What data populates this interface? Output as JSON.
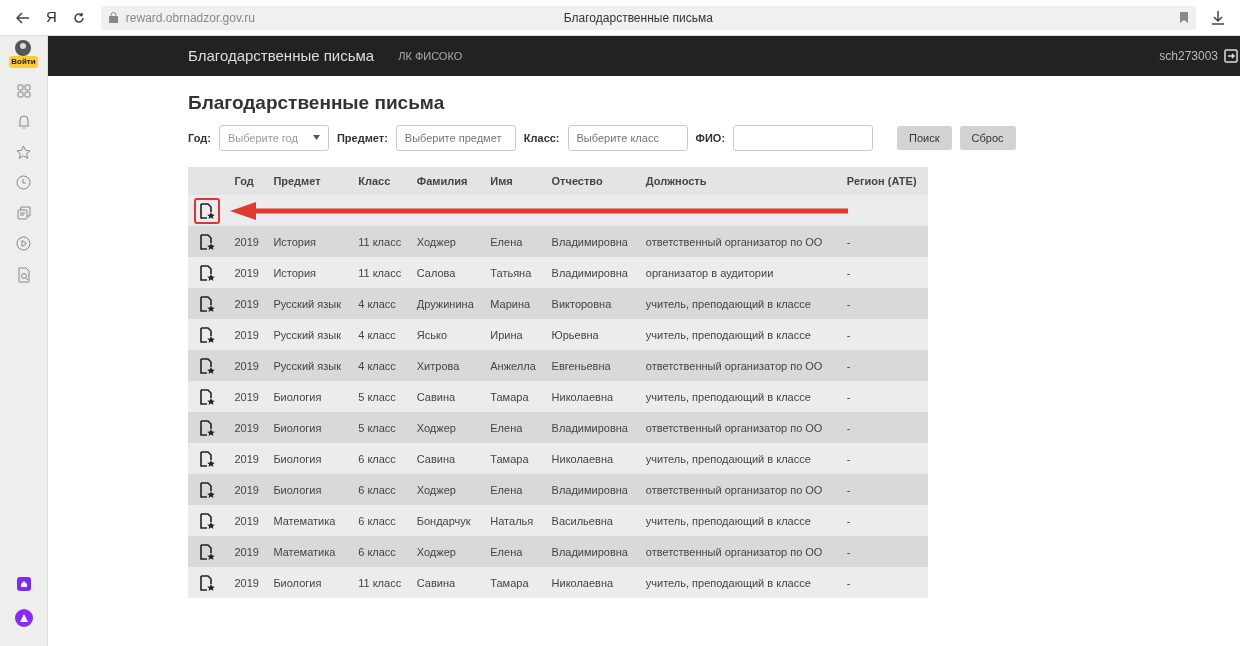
{
  "browser": {
    "logo": "Я",
    "url": "reward.obrnadzor.gov.ru",
    "title": "Благодарственные письма"
  },
  "sidebar": {
    "login": "Войти"
  },
  "navbar": {
    "brand": "Благодарственные письма",
    "links": [
      "ЛК ФИСОКО"
    ],
    "user": "sch273003"
  },
  "heading": "Благодарственные письма",
  "filters": [
    {
      "kind": "select",
      "label": "Год:",
      "placeholder": "Выберите год"
    },
    {
      "kind": "input",
      "label": "Предмет:",
      "placeholder": "Выберите предмет"
    },
    {
      "kind": "input",
      "label": "Класс:",
      "placeholder": "Выберите класс"
    },
    {
      "kind": "input",
      "label": "ФИО:"
    }
  ],
  "buttons": [
    "Поиск",
    "Сброс"
  ],
  "table": {
    "columns": [
      "Год",
      "Предмет",
      "Класс",
      "Фамилия",
      "Имя",
      "Отчество",
      "Должность",
      "Регион (АТЕ)"
    ],
    "rows": [
      {
        "highlighted": true,
        "cells": []
      },
      {
        "highlighted": false,
        "cells": [
          "2019",
          "История",
          "11 класс",
          "Ходжер",
          "Елена",
          "Владимировна",
          "ответственный организатор по ОО",
          "-"
        ]
      },
      {
        "highlighted": false,
        "cells": [
          "2019",
          "История",
          "11 класс",
          "Салова",
          "Татьяна",
          "Владимировна",
          "организатор в аудитории",
          "-"
        ]
      },
      {
        "highlighted": false,
        "cells": [
          "2019",
          "Русский язык",
          "4 класс",
          "Дружинина",
          "Марина",
          "Викторовна",
          "учитель, преподающий в классе",
          "-"
        ]
      },
      {
        "highlighted": false,
        "cells": [
          "2019",
          "Русский язык",
          "4 класс",
          "Ясько",
          "Ирина",
          "Юрьевна",
          "учитель, преподающий в классе",
          "-"
        ]
      },
      {
        "highlighted": false,
        "cells": [
          "2019",
          "Русский язык",
          "4 класс",
          "Хитрова",
          "Анжелла",
          "Евгеньевна",
          "ответственный организатор по ОО",
          "-"
        ]
      },
      {
        "highlighted": false,
        "cells": [
          "2019",
          "Биология",
          "5 класс",
          "Савина",
          "Тамара",
          "Николаевна",
          "учитель, преподающий в классе",
          "-"
        ]
      },
      {
        "highlighted": false,
        "cells": [
          "2019",
          "Биология",
          "5 класс",
          "Ходжер",
          "Елена",
          "Владимировна",
          "ответственный организатор по ОО",
          "-"
        ]
      },
      {
        "highlighted": false,
        "cells": [
          "2019",
          "Биология",
          "6 класс",
          "Савина",
          "Тамара",
          "Николаевна",
          "учитель, преподающий в классе",
          "-"
        ]
      },
      {
        "highlighted": false,
        "cells": [
          "2019",
          "Биология",
          "6 класс",
          "Ходжер",
          "Елена",
          "Владимировна",
          "ответственный организатор по ОО",
          "-"
        ]
      },
      {
        "highlighted": false,
        "cells": [
          "2019",
          "Математика",
          "6 класс",
          "Бондарчук",
          "Наталья",
          "Васильевна",
          "учитель, преподающий в классе",
          "-"
        ]
      },
      {
        "highlighted": false,
        "cells": [
          "2019",
          "Математика",
          "6 класс",
          "Ходжер",
          "Елена",
          "Владимировна",
          "ответственный организатор по ОО",
          "-"
        ]
      },
      {
        "highlighted": false,
        "cells": [
          "2019",
          "Биология",
          "11 класс",
          "Савина",
          "Тамара",
          "Николаевна",
          "учитель, преподающий в классе",
          "-"
        ]
      }
    ]
  }
}
